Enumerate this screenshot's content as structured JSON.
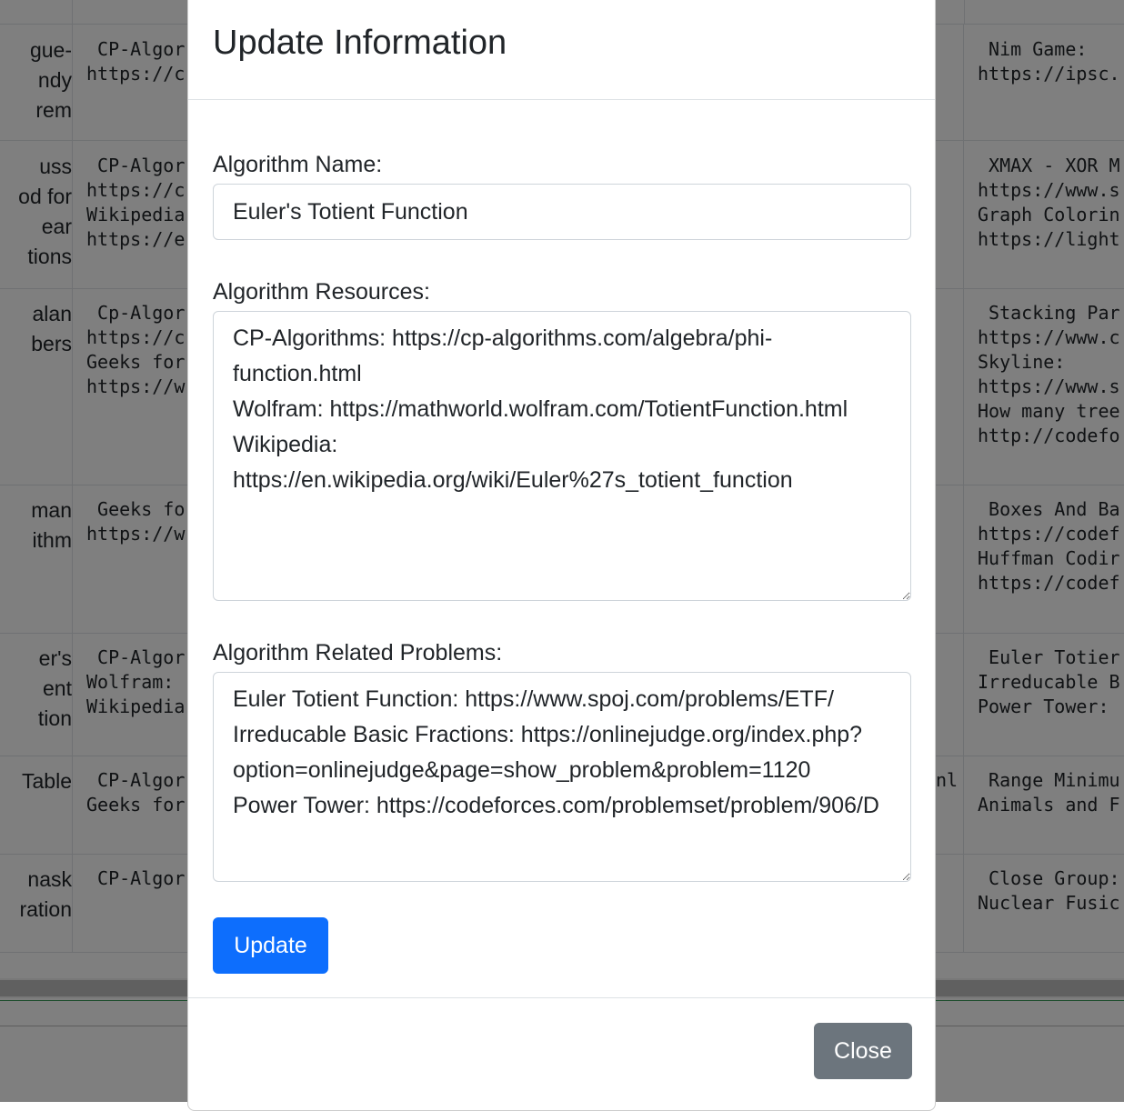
{
  "background_table": {
    "rows": [
      {
        "name": [
          "gue-",
          "ndy",
          "rem"
        ],
        "resources": " CP-Algor\nhttps://c",
        "mid": "",
        "problems": " Nim Game:\nhttps://ipsc."
      },
      {
        "name": [
          "uss",
          "od for",
          "ear",
          "tions"
        ],
        "resources": " CP-Algor\nhttps://c\nWikipedia\nhttps://e",
        "mid": "",
        "problems": " XMAX - XOR M\nhttps://www.s\nGraph Colorin\nhttps://light"
      },
      {
        "name": [
          "alan",
          "bers"
        ],
        "resources": " Cp-Algor\nhttps://c\nGeeks for\nhttps://w",
        "mid": "",
        "problems": " Stacking Par\nhttps://www.c\nSkyline:\nhttps://www.s\nHow many tree\nhttp://codefo"
      },
      {
        "name": [
          "man",
          "ithm"
        ],
        "resources": " Geeks fo\nhttps://w",
        "mid": "",
        "problems": " Boxes And Ba\nhttps://codef\nHuffman Codir\nhttps://codef"
      },
      {
        "name": [
          "er's",
          "ent",
          "tion"
        ],
        "resources": " CP-Algor\nWolfram: \nWikipedia",
        "mid": "",
        "problems": " Euler Totier\nIrreducable B\nPower Tower: "
      },
      {
        "name": [
          "Table"
        ],
        "resources": " CP-Algor\nGeeks for",
        "mid": "nl",
        "problems": " Range Minimu\nAnimals and F"
      },
      {
        "name": [
          "nask",
          "ration"
        ],
        "resources": " CP-Algor",
        "mid": "",
        "problems": " Close Group:\nNuclear Fusic"
      }
    ]
  },
  "modal": {
    "title": "Update Information",
    "name_label": "Algorithm Name:",
    "name_value": "Euler's Totient Function",
    "resources_label": "Algorithm Resources:",
    "resources_value": "CP-Algorithms: https://cp-algorithms.com/algebra/phi-function.html\nWolfram: https://mathworld.wolfram.com/TotientFunction.html\nWikipedia: https://en.wikipedia.org/wiki/Euler%27s_totient_function",
    "problems_label": "Algorithm Related Problems:",
    "problems_value": "Euler Totient Function: https://www.spoj.com/problems/ETF/\nIrreducable Basic Fractions: https://onlinejudge.org/index.php?option=onlinejudge&page=show_problem&problem=1120\nPower Tower: https://codeforces.com/problemset/problem/906/D",
    "update_button": "Update",
    "close_button": "Close"
  }
}
